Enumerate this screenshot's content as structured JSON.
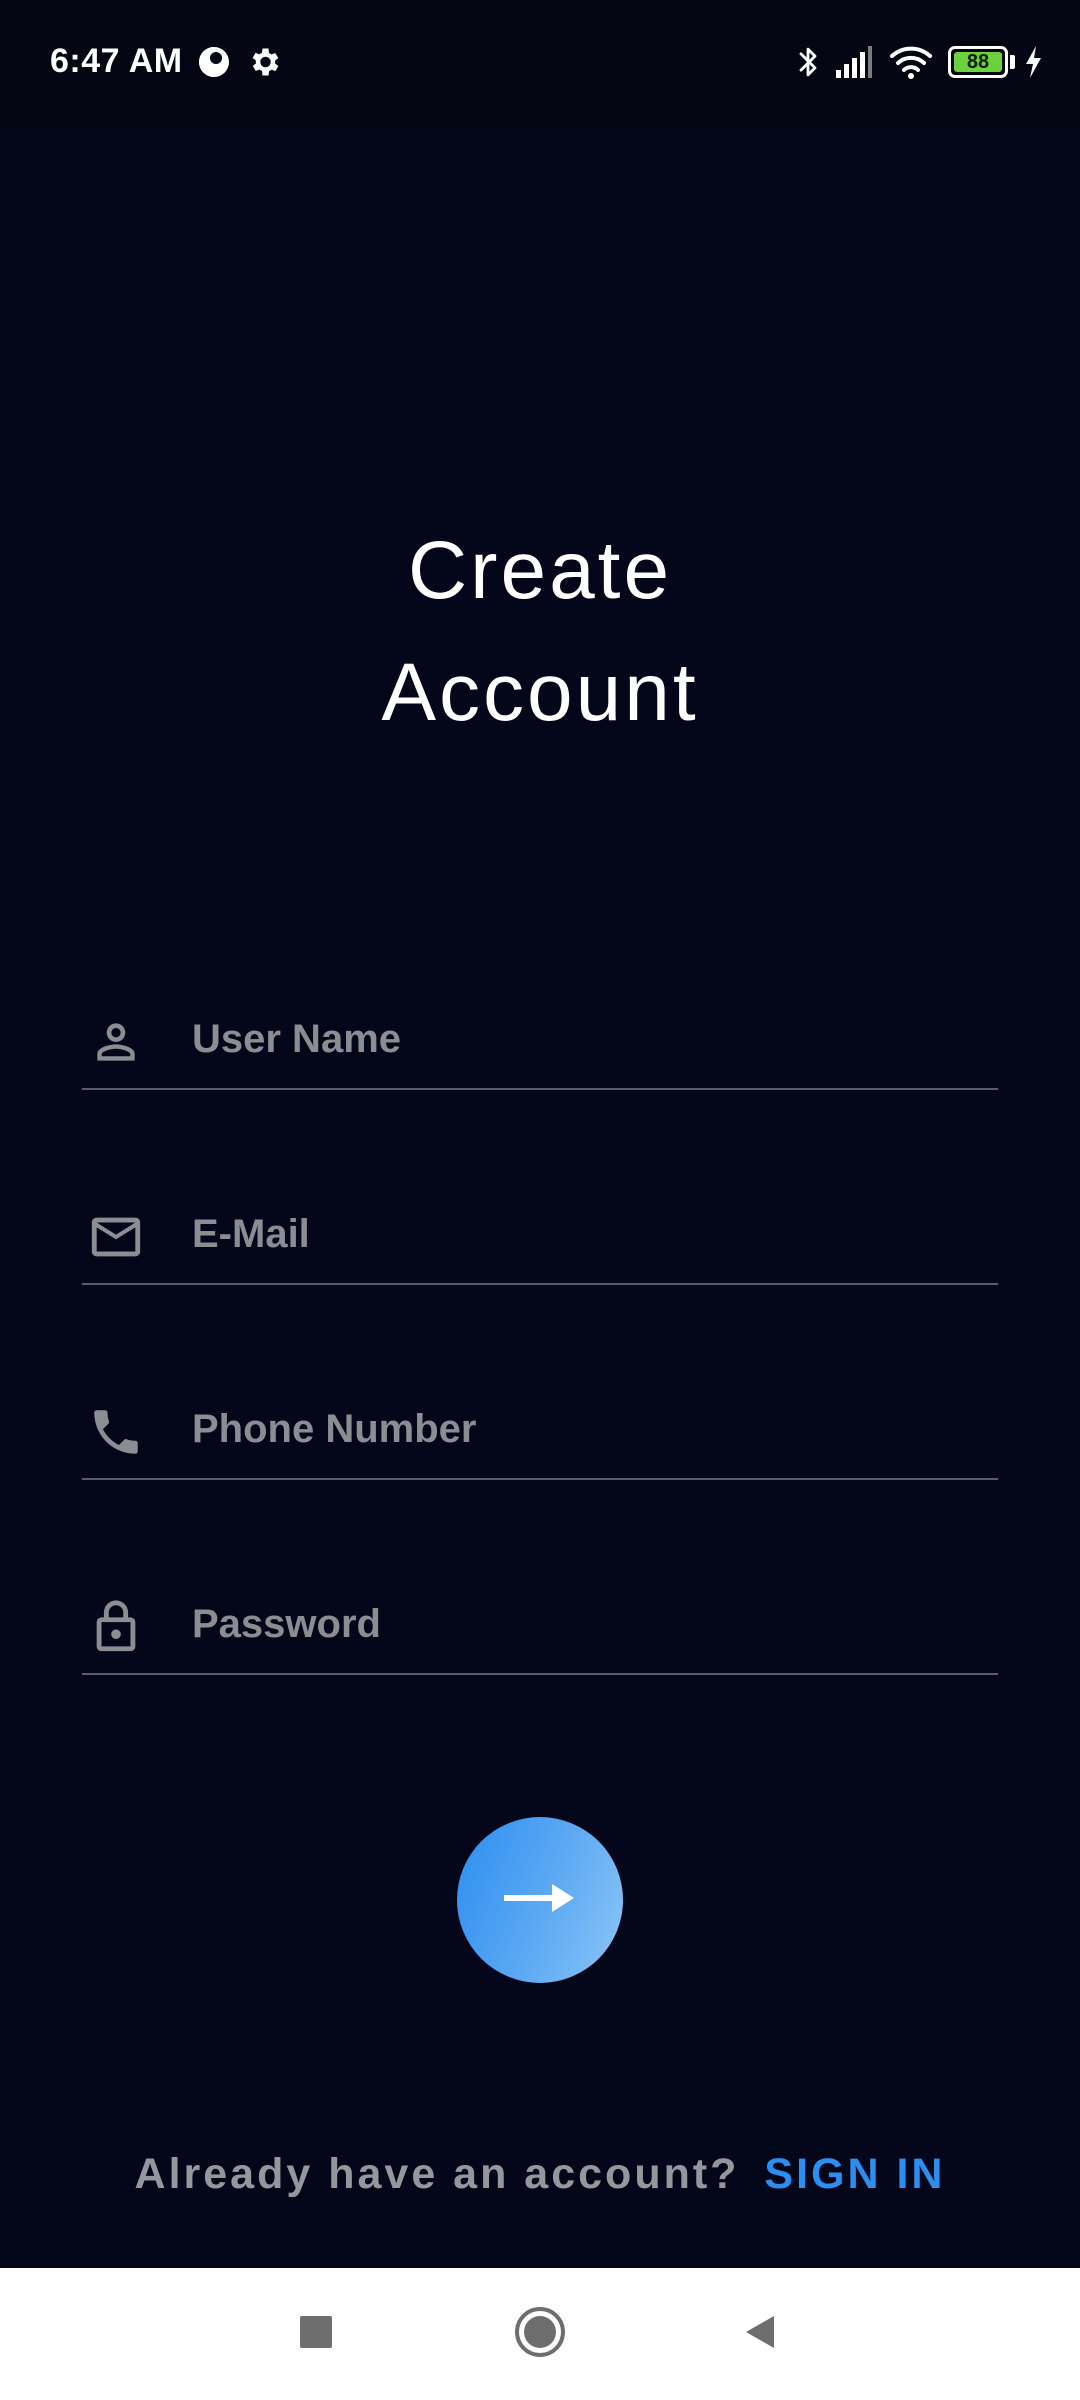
{
  "status_bar": {
    "time": "6:47 AM",
    "left_icons": [
      "data-saver-icon",
      "settings-gear-icon"
    ],
    "right_icons": [
      "bluetooth-icon",
      "signal-icon",
      "wifi-icon",
      "battery-icon",
      "charging-bolt-icon"
    ],
    "battery_level": "88"
  },
  "page": {
    "title_line1": "Create",
    "title_line2": "Account"
  },
  "form": {
    "fields": [
      {
        "icon": "person-icon",
        "placeholder": "User Name",
        "value": ""
      },
      {
        "icon": "mail-icon",
        "placeholder": "E-Mail",
        "value": ""
      },
      {
        "icon": "phone-icon",
        "placeholder": "Phone Number",
        "value": ""
      },
      {
        "icon": "lock-icon",
        "placeholder": "Password",
        "value": ""
      }
    ],
    "submit_icon": "arrow-right-icon"
  },
  "footer": {
    "question": "Already have an account?",
    "link": "SIGN IN"
  },
  "nav_bar": {
    "buttons": [
      "recents-square-icon",
      "home-circle-icon",
      "back-triangle-icon"
    ]
  },
  "colors": {
    "background": "#04061a",
    "accent": "#2b8ef0",
    "placeholder": "#8b8d93",
    "divider": "#5a5d6c",
    "battery_fill": "#6bd13d"
  }
}
